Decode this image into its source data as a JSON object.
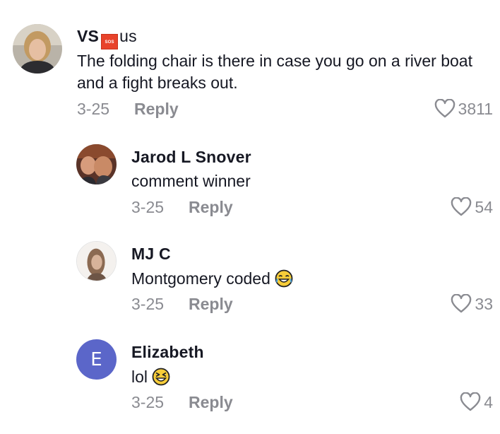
{
  "comments": [
    {
      "username": "VS",
      "username_badge": "SOS",
      "username_suffix": "us",
      "text": "The folding chair is there in case you go on a river boat and a fight breaks out.",
      "date": "3-25",
      "reply_label": "Reply",
      "likes": "3811"
    },
    {
      "username": "Jarod L Snover",
      "text": "comment winner",
      "date": "3-25",
      "reply_label": "Reply",
      "likes": "54"
    },
    {
      "username": "MJ C",
      "text": "Montgomery coded",
      "emoji": "face-with-tears-of-joy-emoji",
      "date": "3-25",
      "reply_label": "Reply",
      "likes": "33"
    },
    {
      "username": "Elizabeth",
      "avatar_letter": "E",
      "text": "lol",
      "emoji": "grinning-squinting-face-emoji",
      "date": "3-25",
      "reply_label": "Reply",
      "likes": "4"
    }
  ],
  "colors": {
    "text": "#161823",
    "muted": "#8a8b91",
    "letter_avatar": "#5b66c9",
    "badge": "#e8432b"
  },
  "icons": {
    "like": "heart-outline-icon"
  }
}
